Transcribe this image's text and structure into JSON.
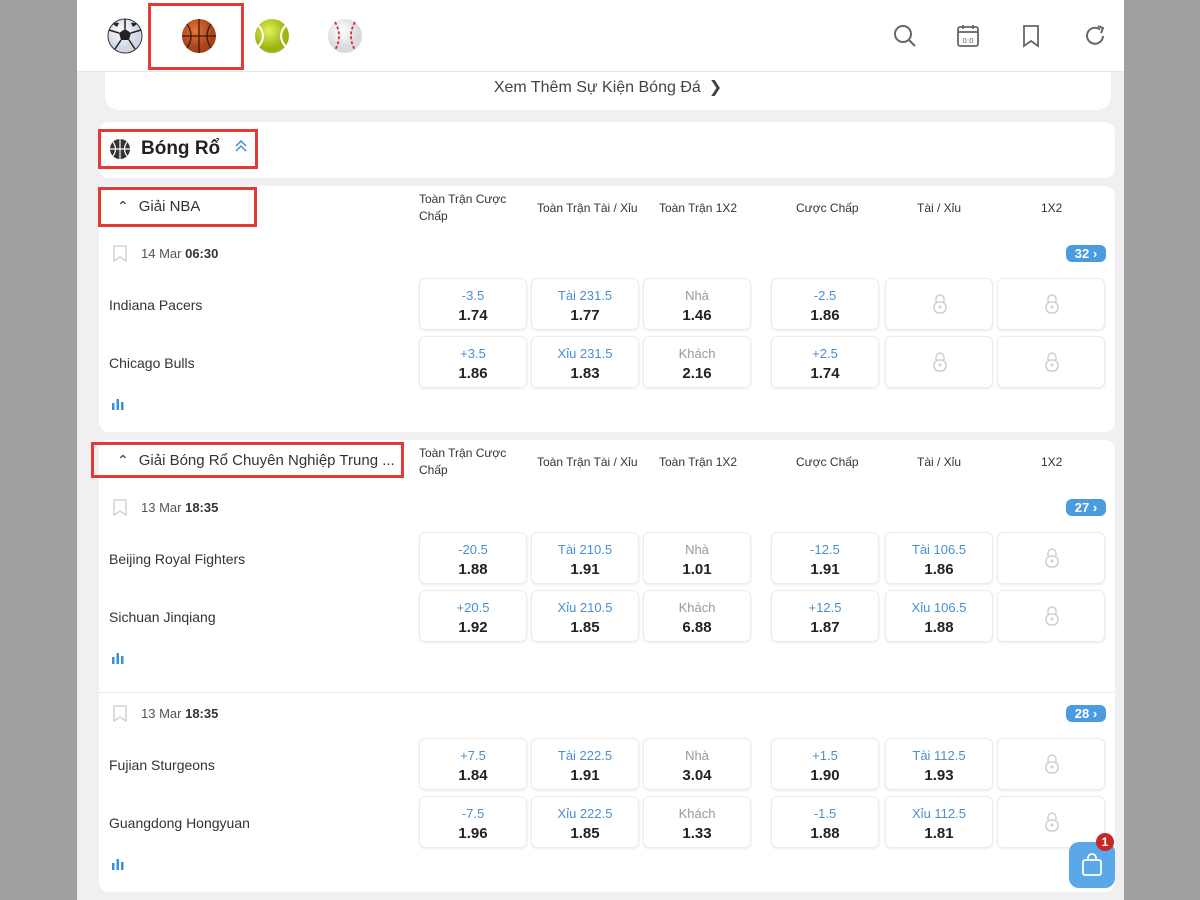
{
  "sports": [
    {
      "icon": "soccer-ball-icon"
    },
    {
      "icon": "basketball-icon",
      "active": true
    },
    {
      "icon": "tennis-ball-icon"
    },
    {
      "icon": "baseball-icon"
    }
  ],
  "tools": [
    "search-icon",
    "scoreboard-calendar-icon",
    "bookmark-icon",
    "refresh-icon"
  ],
  "more_events": "Xem Thêm Sự Kiện Bóng Đá",
  "section": {
    "title": "Bóng Rổ"
  },
  "columns": {
    "c1": "Toàn Trận Cược Chấp",
    "c2": "Toàn Trận Tài / Xỉu",
    "c3": "Toàn Trận 1X2",
    "c4": "Cược Chấp",
    "c5": "Tài / Xỉu",
    "c6": "1X2"
  },
  "leagues": [
    {
      "name": "Giải NBA",
      "matches": [
        {
          "date": "14 Mar",
          "time": "06:30",
          "count": "32",
          "home": {
            "team": "Indiana Pacers",
            "ah_line": "-3.5",
            "ah_odd": "1.74",
            "ou_line": "Tài 231.5",
            "ou_odd": "1.77",
            "x_lbl": "Nhà",
            "x_odd": "1.46",
            "h_line": "-2.5",
            "h_odd": "1.86"
          },
          "away": {
            "team": "Chicago Bulls",
            "ah_line": "+3.5",
            "ah_odd": "1.86",
            "ou_line": "Xỉu 231.5",
            "ou_odd": "1.83",
            "x_lbl": "Khách",
            "x_odd": "2.16",
            "h_line": "+2.5",
            "h_odd": "1.74"
          }
        }
      ]
    },
    {
      "name": "Giải Bóng Rổ Chuyên Nghiệp Trung ...",
      "matches": [
        {
          "date": "13 Mar",
          "time": "18:35",
          "count": "27",
          "home": {
            "team": "Beijing Royal Fighters",
            "ah_line": "-20.5",
            "ah_odd": "1.88",
            "ou_line": "Tài 210.5",
            "ou_odd": "1.91",
            "x_lbl": "Nhà",
            "x_odd": "1.01",
            "h_line": "-12.5",
            "h_odd": "1.91",
            "t_line": "Tài 106.5",
            "t_odd": "1.86"
          },
          "away": {
            "team": "Sichuan Jinqiang",
            "ah_line": "+20.5",
            "ah_odd": "1.92",
            "ou_line": "Xỉu 210.5",
            "ou_odd": "1.85",
            "x_lbl": "Khách",
            "x_odd": "6.88",
            "h_line": "+12.5",
            "h_odd": "1.87",
            "t_line": "Xỉu 106.5",
            "t_odd": "1.88"
          }
        },
        {
          "date": "13 Mar",
          "time": "18:35",
          "count": "28",
          "home": {
            "team": "Fujian Sturgeons",
            "ah_line": "+7.5",
            "ah_odd": "1.84",
            "ou_line": "Tài 222.5",
            "ou_odd": "1.91",
            "x_lbl": "Nhà",
            "x_odd": "3.04",
            "h_line": "+1.5",
            "h_odd": "1.90",
            "t_line": "Tài 112.5",
            "t_odd": "1.93"
          },
          "away": {
            "team": "Guangdong Hongyuan",
            "ah_line": "-7.5",
            "ah_odd": "1.96",
            "ou_line": "Xỉu 222.5",
            "ou_odd": "1.85",
            "x_lbl": "Khách",
            "x_odd": "1.33",
            "h_line": "-1.5",
            "h_odd": "1.88",
            "t_line": "Xỉu 112.5",
            "t_odd": "1.81"
          }
        }
      ]
    }
  ],
  "cart": {
    "badge": "1"
  },
  "colors": {
    "accent": "#4a9be0",
    "highlight": "#e53935",
    "badge": "#c62828"
  }
}
